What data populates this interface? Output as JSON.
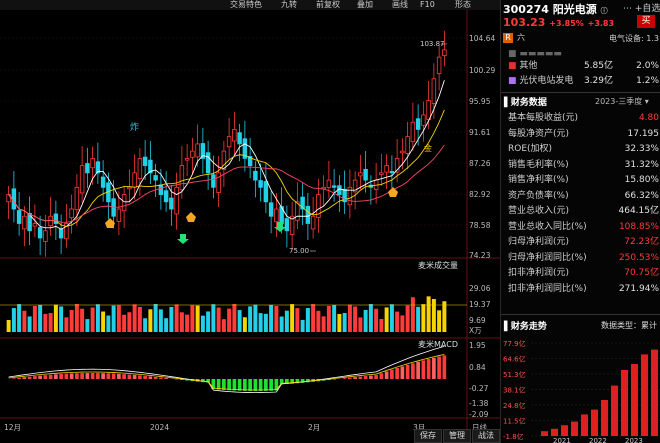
{
  "toolbar": {
    "items": [
      "交易特色",
      "九转",
      "前复权",
      "叠加",
      "画线",
      "F10",
      "形态"
    ]
  },
  "main_chart": {
    "price_ticks": [
      "104.64",
      "100.29",
      "95.95",
      "91.61",
      "87.26",
      "82.92",
      "78.58",
      "74.23"
    ],
    "high_label": "103.87",
    "low_label": "75.00",
    "annotation_zha": "炸",
    "annotation_jin": "金",
    "month_labels": [
      "12月",
      "2024",
      "2月",
      "3月"
    ],
    "range_button": "日线"
  },
  "volume_panel": {
    "title": "麦米成交量",
    "ticks": [
      "29.06",
      "19.37",
      "9.69"
    ],
    "unit": "X万"
  },
  "macd_panel": {
    "title": "麦米MACD",
    "ticks": [
      "1.95",
      "0.84",
      "-0.27",
      "-1.38",
      "-2.09"
    ]
  },
  "stock": {
    "code": "300274",
    "name": "阳光电源",
    "price": "103.23",
    "change_pct": "+3.85%",
    "change": "+3.83",
    "buy_label": "买",
    "add_label": "+自选",
    "menu_r": "R",
    "menu_six": "六",
    "sub_label": "电气设备",
    "sub_value": "1.3"
  },
  "business": [
    {
      "name": "其他",
      "value": "5.85亿",
      "pct": "2.0%",
      "color": "#e03030"
    },
    {
      "name": "光伏电站发电",
      "value": "3.29亿",
      "pct": "1.2%",
      "color": "#b070ff"
    }
  ],
  "finance": {
    "title": "财务数据",
    "period": "2023-三季度",
    "rows": [
      {
        "k": "基本每股收益(元)",
        "v": "4.80",
        "red": true
      },
      {
        "k": "每股净资产(元)",
        "v": "17.195",
        "red": false
      },
      {
        "k": "ROE(加权)",
        "v": "32.33%",
        "red": false
      },
      {
        "k": "销售毛利率(%)",
        "v": "31.32%",
        "red": false
      },
      {
        "k": "销售净利率(%)",
        "v": "15.80%",
        "red": false
      },
      {
        "k": "资产负债率(%)",
        "v": "66.32%",
        "red": false
      },
      {
        "k": "营业总收入(元)",
        "v": "464.15亿",
        "red": false
      },
      {
        "k": "营业总收入同比(%)",
        "v": "108.85%",
        "red": true
      },
      {
        "k": "归母净利润(元)",
        "v": "72.23亿",
        "red": true
      },
      {
        "k": "归母净利润同比(%)",
        "v": "250.53%",
        "red": true
      },
      {
        "k": "扣非净利润(元)",
        "v": "70.75亿",
        "red": true
      },
      {
        "k": "扣非净利润同比(%)",
        "v": "271.94%",
        "red": false
      }
    ]
  },
  "finance_trend": {
    "title": "财务走势",
    "type_label": "数据类型：累计",
    "ticks": [
      "77.9亿",
      "64.6亿",
      "51.3亿",
      "38.1亿",
      "24.8亿",
      "11.5亿",
      "-1.8亿"
    ],
    "years": [
      "2021",
      "2022",
      "2023"
    ]
  },
  "bottom_buttons": [
    "保存",
    "管理",
    "战法"
  ],
  "colors": {
    "up": "#ff3b3b",
    "down": "#22d0e8",
    "ma5": "#ffffff",
    "ma10": "#f5d400",
    "ma20": "#ff4466",
    "volume_yellow": "#f5d400"
  }
}
